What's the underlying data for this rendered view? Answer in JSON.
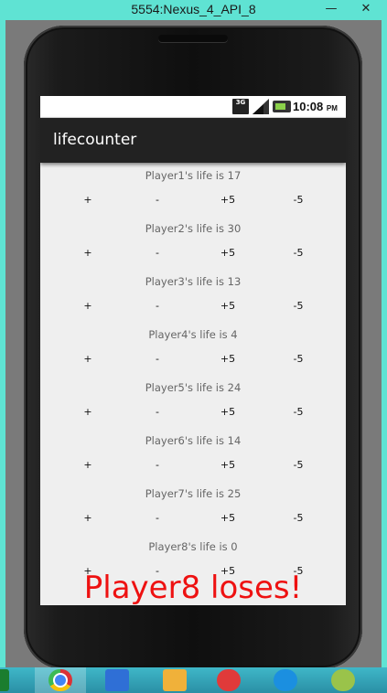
{
  "window": {
    "title": "5554:Nexus_4_API_8",
    "minimize": "—",
    "close": "✕"
  },
  "statusbar": {
    "network": "3G",
    "time": "10:08",
    "ampm": "PM"
  },
  "app": {
    "title": "lifecounter"
  },
  "players": [
    {
      "label": "Player1's life is 17"
    },
    {
      "label": "Player2's life is 30"
    },
    {
      "label": "Player3's life is 13"
    },
    {
      "label": "Player4's life is 4"
    },
    {
      "label": "Player5's life is 24"
    },
    {
      "label": "Player6's life is 14"
    },
    {
      "label": "Player7's life is 25"
    },
    {
      "label": "Player8's life is 0"
    }
  ],
  "buttons": {
    "plus": "+",
    "minus": "-",
    "plus5": "+5",
    "minus5": "-5"
  },
  "message": "Player8 loses!",
  "colors": {
    "message": "#ee1111",
    "actionbar": "#222222",
    "screen": "#efefef"
  },
  "taskbar": {
    "icons": [
      "start-icon",
      "chrome-icon",
      "store-icon",
      "folder-icon",
      "music-icon",
      "video-icon",
      "android-icon"
    ]
  }
}
